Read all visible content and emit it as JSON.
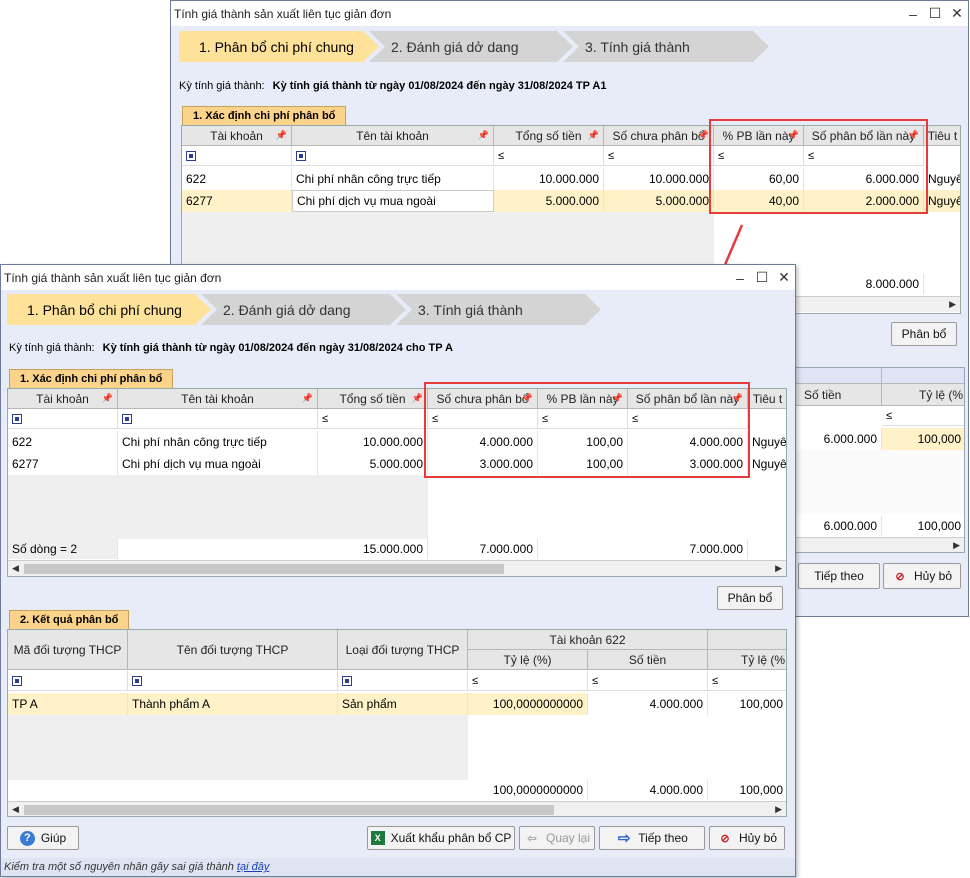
{
  "back": {
    "title": "Tính giá thành sản xuất liên tục giản đơn",
    "steps": [
      "1. Phân bổ chi phí chung",
      "2. Đánh giá dở dang",
      "3. Tính giá thành"
    ],
    "ky_label": "Kỳ tính giá thành:",
    "ky_value": "Kỳ tính giá thành từ ngày 01/08/2024 đến ngày 31/08/2024 TP A1",
    "section1": "1. Xác định chi phí phân bổ",
    "headers": [
      "Tài khoản",
      "Tên tài khoản",
      "Tổng số tiền",
      "Số chưa phân bổ",
      "% PB lần này",
      "Số phân bổ lần này",
      "Tiêu t"
    ],
    "filter": "≤",
    "rows": [
      {
        "tk": "622",
        "ten": "Chi phí nhân công trực tiếp",
        "tong": "10.000.000",
        "chua": "10.000.000",
        "pb": "60,00",
        "so": "6.000.000",
        "tieu": "Nguyê"
      },
      {
        "tk": "6277",
        "ten": "Chi phí dịch vụ mua ngoài",
        "tong": "5.000.000",
        "chua": "5.000.000",
        "pb": "40,00",
        "so": "2.000.000",
        "tieu": "Nguyê"
      }
    ],
    "total_so": "8.000.000",
    "phanbo": "Phân bổ",
    "res_headers": [
      "Số tiền",
      "Tỷ lệ (%"
    ],
    "res_row": {
      "sotien": "6.000.000",
      "tyle": "100,000"
    },
    "res_total": {
      "sotien": "6.000.000",
      "tyle": "100,000"
    },
    "tiep_theo": "Tiếp theo",
    "huy_bo": "Hủy bỏ"
  },
  "front": {
    "title": "Tính giá thành sản xuất liên tục giản đơn",
    "steps": [
      "1. Phân bổ chi phí chung",
      "2. Đánh giá dở dang",
      "3. Tính giá thành"
    ],
    "ky_label": "Kỳ tính giá thành:",
    "ky_value": "Kỳ tính giá thành từ ngày 01/08/2024 đến ngày 31/08/2024 cho TP A",
    "section1": "1. Xác định chi phí phân bổ",
    "headers": [
      "Tài khoản",
      "Tên tài khoản",
      "Tổng số tiền",
      "Số chưa phân bổ",
      "% PB lần này",
      "Số phân bổ lần này",
      "Tiêu t"
    ],
    "filter": "≤",
    "rows": [
      {
        "tk": "622",
        "ten": "Chi phí nhân công trực tiếp",
        "tong": "10.000.000",
        "chua": "4.000.000",
        "pb": "100,00",
        "so": "4.000.000",
        "tieu": "Nguyê"
      },
      {
        "tk": "6277",
        "ten": "Chi phí dịch vụ mua ngoài",
        "tong": "5.000.000",
        "chua": "3.000.000",
        "pb": "100,00",
        "so": "3.000.000",
        "tieu": "Nguyê"
      }
    ],
    "footer": {
      "count": "Số dòng = 2",
      "tong": "15.000.000",
      "chua": "7.000.000",
      "so": "7.000.000"
    },
    "phanbo": "Phân bổ",
    "section2": "2. Kết quả phân bổ",
    "res_headers": {
      "ma": "Mã đối tượng THCP",
      "ten": "Tên đối tượng THCP",
      "loai": "Loại đối tượng THCP",
      "tk622": "Tài khoản 622",
      "tyle": "Tỷ lệ (%)",
      "sotien": "Số tiền",
      "tyle2": "Tỷ lệ (%"
    },
    "res_row": {
      "ma": "TP A",
      "ten": "Thành phẩm A",
      "loai": "Sản phẩm",
      "tyle": "100,0000000000",
      "sotien": "4.000.000",
      "tyle2": "100,000"
    },
    "res_total": {
      "tyle": "100,0000000000",
      "sotien": "4.000.000",
      "tyle2": "100,000"
    },
    "buttons": {
      "giup": "Giúp",
      "xuat": "Xuất khẩu phân bổ CP",
      "quaylai": "Quay lại",
      "tieptheo": "Tiếp theo",
      "huybo": "Hủy bỏ"
    },
    "status": "Kiểm tra một số nguyên nhân gây sai giá thành",
    "status_link": "tại đây"
  },
  "colors": {
    "highlight": "#e53b3b",
    "step_active": "#ffe29a",
    "section_tab": "#fbd38a"
  }
}
